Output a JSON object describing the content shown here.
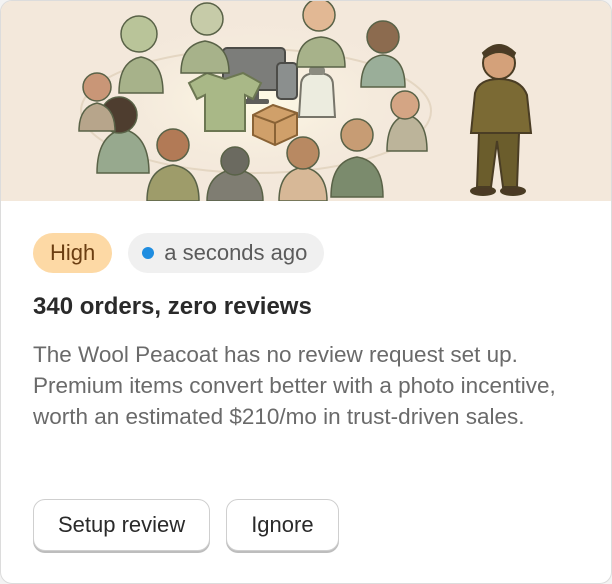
{
  "card": {
    "illustration": {
      "description_icon": "people-around-products-illustration",
      "background": "#f3e8db"
    },
    "priority_label": "High",
    "status_dot_color": "#1f8de0",
    "time_label": "a seconds ago",
    "title": "340 orders, zero reviews",
    "description": "The Wool Peacoat has no review request set up. Premium items convert better with a photo incentive, worth an estimated $210/mo in trust-driven sales.",
    "primary_action": "Setup review",
    "secondary_action": "Ignore"
  }
}
